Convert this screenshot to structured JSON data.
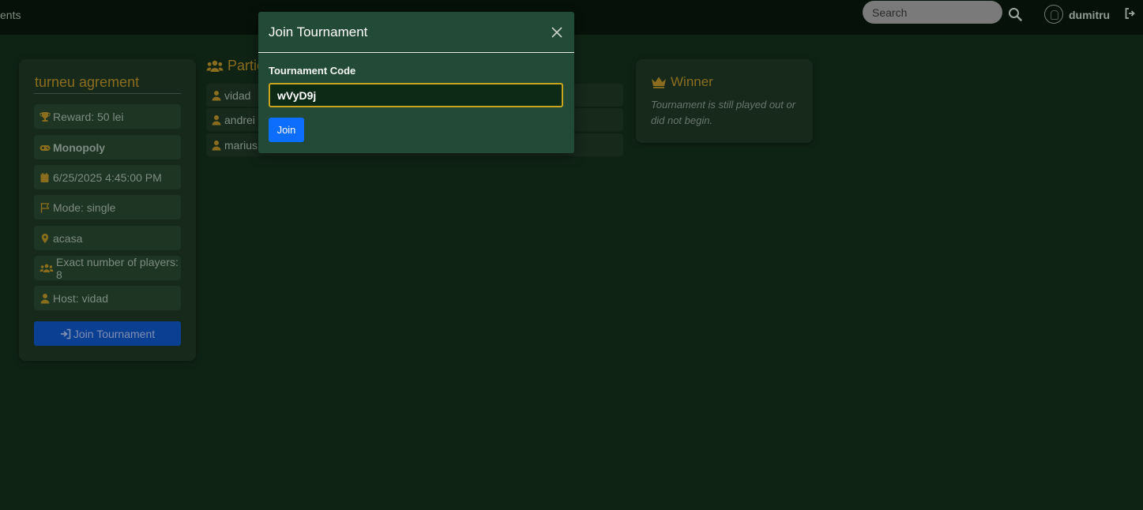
{
  "navbar": {
    "brand_partial": "ents",
    "search_placeholder": "Search",
    "username": "dumitru"
  },
  "tournament": {
    "title": "turneu agrement",
    "details": [
      {
        "icon": "trophy-icon",
        "text": "Reward: 50 lei",
        "bold": false
      },
      {
        "icon": "gamepad-icon",
        "text": "Monopoly",
        "bold": true
      },
      {
        "icon": "calendar-icon",
        "text": "6/25/2025 4:45:00 PM",
        "bold": false
      },
      {
        "icon": "flag-icon",
        "text": "Mode: single",
        "bold": false
      },
      {
        "icon": "location-pin-icon",
        "text": "acasa",
        "bold": false
      },
      {
        "icon": "users-icon",
        "text": "Exact number of players: 8",
        "bold": false
      },
      {
        "icon": "user-icon",
        "text": "Host: vidad",
        "bold": false
      }
    ],
    "join_button_label": "Join Tournament"
  },
  "participants": {
    "header_visible": "Partic",
    "list": [
      "vidad",
      "andrei",
      "marius"
    ]
  },
  "winner": {
    "title": "Winner",
    "status": "Tournament is still played out or did not begin."
  },
  "modal": {
    "title": "Join Tournament",
    "field_label": "Tournament Code",
    "code_value": "wVyD9j",
    "join_label": "Join"
  },
  "colors": {
    "background": "#0f2314",
    "accent_gold": "#8a6d1e",
    "primary_blue": "#0d6efd",
    "modal_bg": "#234a36",
    "input_border": "#c9a41f"
  }
}
